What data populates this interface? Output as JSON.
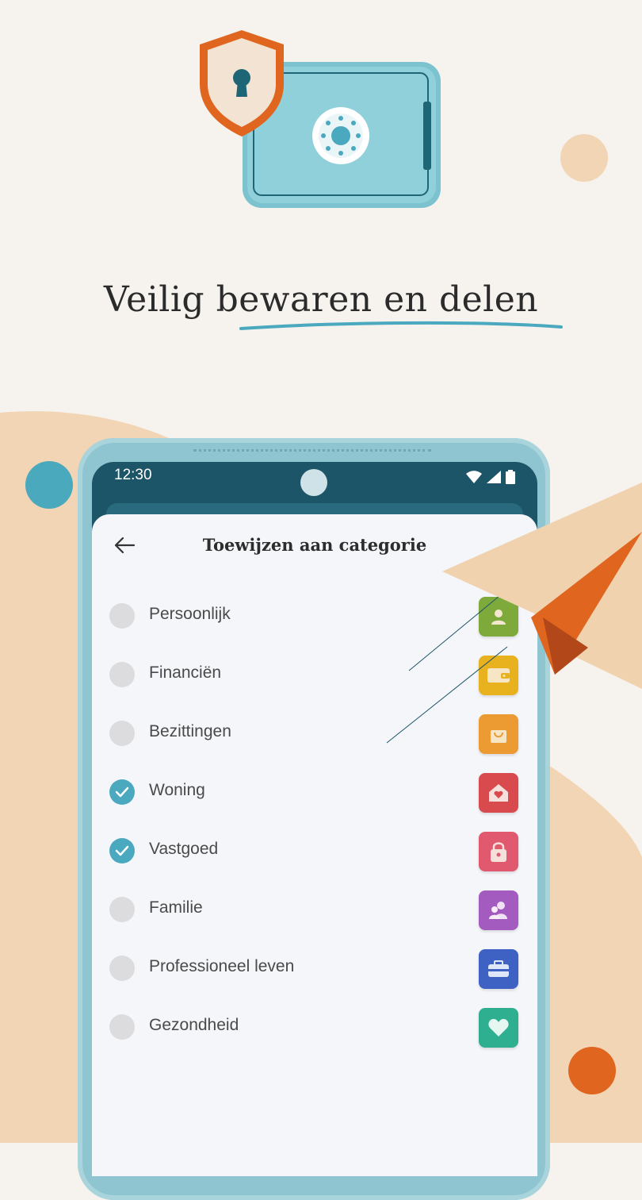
{
  "headline": {
    "part1": "Veilig",
    "part2": "bewaren en delen"
  },
  "status_bar": {
    "time": "12:30",
    "icons": [
      "wifi-icon",
      "signal-icon",
      "battery-icon"
    ]
  },
  "sheet": {
    "title": "Toewijzen aan categorie",
    "back_icon": "arrow-left-icon"
  },
  "categories": [
    {
      "label": "Persoonlijk",
      "checked": false,
      "icon": "person-icon",
      "color": "#7daa3a"
    },
    {
      "label": "Financiën",
      "checked": false,
      "icon": "wallet-icon",
      "color": "#e8b21f"
    },
    {
      "label": "Bezittingen",
      "checked": false,
      "icon": "shopping-bag-icon",
      "color": "#ec9a32"
    },
    {
      "label": "Woning",
      "checked": true,
      "icon": "house-heart-icon",
      "color": "#d84a4e"
    },
    {
      "label": "Vastgoed",
      "checked": true,
      "icon": "lock-icon",
      "color": "#e0596f"
    },
    {
      "label": "Familie",
      "checked": false,
      "icon": "family-icon",
      "color": "#a45bbf"
    },
    {
      "label": "Professioneel leven",
      "checked": false,
      "icon": "briefcase-icon",
      "color": "#3d62c4"
    },
    {
      "label": "Gezondheid",
      "checked": false,
      "icon": "heart-icon",
      "color": "#2eaf8f"
    }
  ],
  "colors": {
    "background": "#f6f3ef",
    "peach": "#f2d5b4",
    "teal": "#4aa8bf",
    "orange": "#e06a26"
  }
}
